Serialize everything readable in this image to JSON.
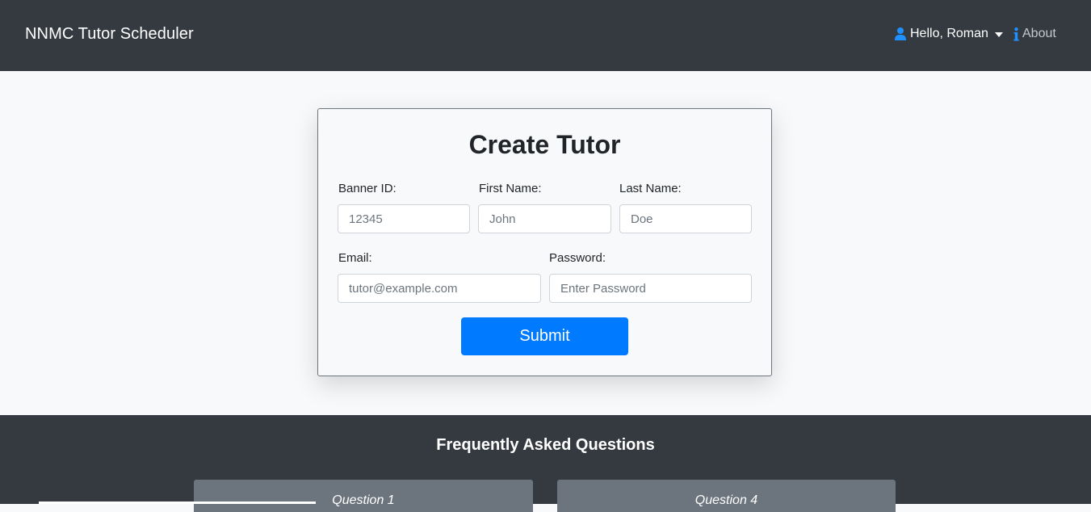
{
  "navbar": {
    "brand": "NNMC Tutor Scheduler",
    "user_greeting": "Hello, Roman",
    "about_label": "About"
  },
  "form": {
    "title": "Create Tutor",
    "banner_id_label": "Banner ID:",
    "banner_id_placeholder": "12345",
    "first_name_label": "First Name:",
    "first_name_placeholder": "John",
    "last_name_label": "Last Name:",
    "last_name_placeholder": "Doe",
    "email_label": "Email:",
    "email_placeholder": "tutor@example.com",
    "password_label": "Password:",
    "password_placeholder": "Enter Password",
    "submit_label": "Submit"
  },
  "faq": {
    "title": "Frequently Asked Questions",
    "questions": [
      "Question 1",
      "Question 4"
    ]
  },
  "colors": {
    "navbar_bg": "#343a40",
    "page_bg": "#f8f9fa",
    "primary": "#007bff",
    "faq_card_bg": "#6c757d"
  }
}
